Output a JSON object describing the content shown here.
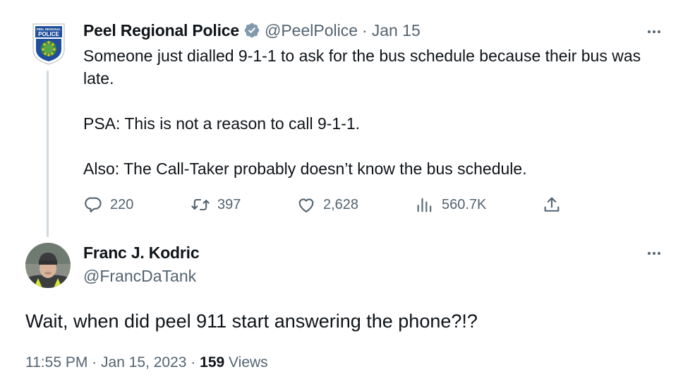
{
  "original_tweet": {
    "author_name": "Peel Regional Police",
    "handle": "@PeelPolice",
    "separator": "·",
    "date": "Jan 15",
    "avatar_icon": "police-badge-icon",
    "verified_icon": "verified-badge-icon",
    "badge_text_top": "PEEL REGIONAL",
    "badge_text_main": "POLICE",
    "paragraphs": [
      "Someone just dialled 9-1-1 to ask for the bus schedule because their bus was late.",
      "PSA: This is not a reason to call 9-1-1.",
      "Also: The Call-Taker probably doesn’t know the bus schedule."
    ],
    "stats": {
      "replies": "220",
      "retweets": "397",
      "likes": "2,628",
      "views": "560.7K"
    }
  },
  "reply_tweet": {
    "author_name": "Franc J. Kodric",
    "handle": "@FrancDaTank",
    "text": "Wait, when did peel 911 start answering the phone?!?",
    "time": "11:55 PM",
    "separator": "·",
    "date": "Jan 15, 2023",
    "separator2": "·",
    "views_count": "159",
    "views_label": " Views"
  },
  "colors": {
    "text": "#0f1419",
    "muted": "#536471",
    "thread_line": "#cfd9de",
    "verified": "#829aab",
    "badge_blue": "#1f4f9c",
    "badge_green": "#3e8a35"
  }
}
